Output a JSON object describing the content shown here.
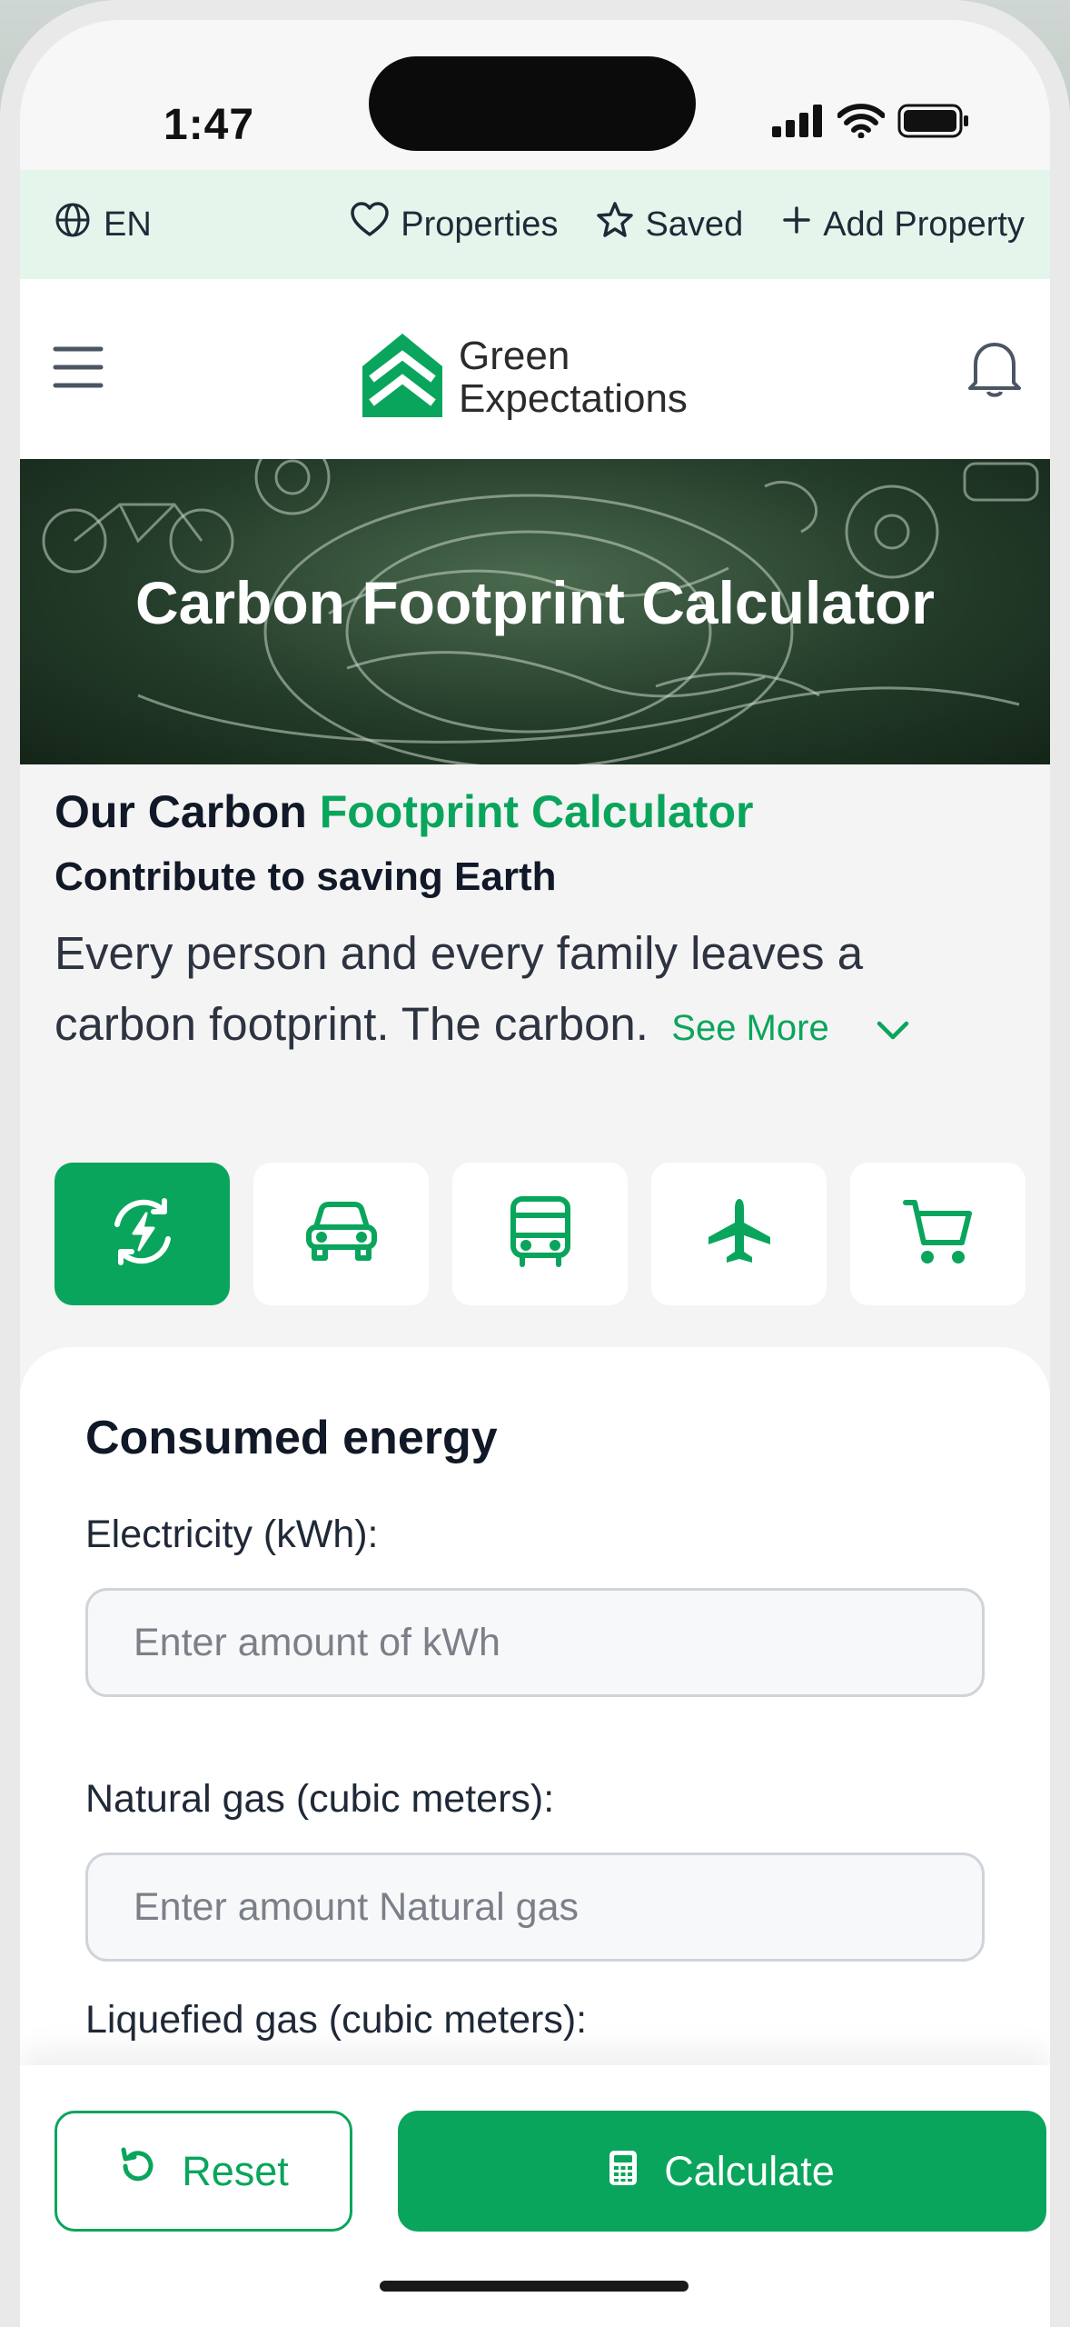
{
  "status_bar": {
    "time": "1:47"
  },
  "top_bar": {
    "language": "EN",
    "links": [
      "Properties",
      "Saved",
      "Add Property"
    ]
  },
  "header": {
    "logo_line1": "Green",
    "logo_line2": "Expectations"
  },
  "hero": {
    "title": "Carbon Footprint Calculator"
  },
  "intro": {
    "heading_prefix": "Our Carbon ",
    "heading_accent": "Footprint Calculator",
    "subheading": "Contribute to saving Earth",
    "body": "Every person and every family leaves a carbon footprint. The carbon.",
    "see_more": "See More"
  },
  "categories": [
    {
      "icon": "energy-icon",
      "active": true
    },
    {
      "icon": "car-icon",
      "active": false
    },
    {
      "icon": "bus-icon",
      "active": false
    },
    {
      "icon": "airplane-icon",
      "active": false
    },
    {
      "icon": "cart-icon",
      "active": false
    }
  ],
  "form": {
    "title": "Consumed energy",
    "electricity_label": "Electricity (kWh):",
    "electricity_placeholder": "Enter amount of kWh",
    "gas_label": "Natural gas (cubic meters):",
    "gas_placeholder": "Enter amount Natural gas",
    "liquefied_label": "Liquefied gas (cubic meters):"
  },
  "actions": {
    "reset": "Reset",
    "calculate": "Calculate"
  },
  "colors": {
    "brand": "#0aa55c",
    "topbar_bg": "#e4f6ec"
  }
}
